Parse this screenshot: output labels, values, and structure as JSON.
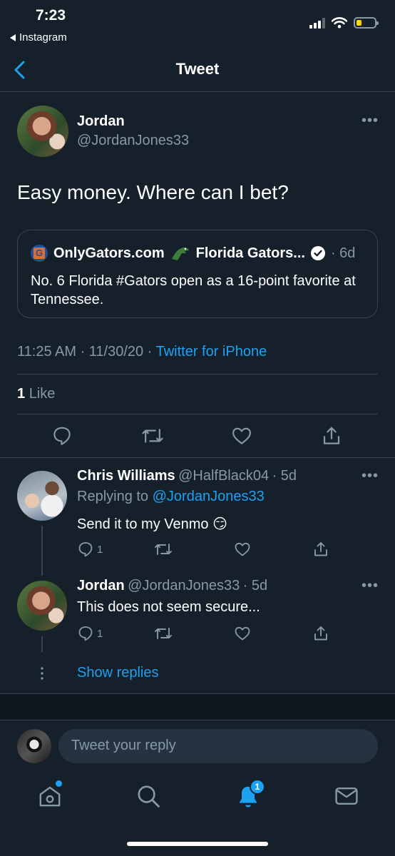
{
  "status_bar": {
    "time": "7:23",
    "back_app": "Instagram"
  },
  "header": {
    "title": "Tweet"
  },
  "main_tweet": {
    "name": "Jordan",
    "handle": "@JordanJones33",
    "text": "Easy money. Where can I bet?",
    "quote": {
      "site": "OnlyGators.com",
      "name": "Florida Gators...",
      "time": "· 6d",
      "text": "No. 6 Florida #Gators open as a 16-point favorite at Tennessee."
    },
    "time": "11:25 AM · 11/30/20 ·",
    "source": "Twitter for iPhone",
    "likes_count": "1",
    "likes_label": "Like"
  },
  "replies": [
    {
      "name": "Chris Williams",
      "handle": "@HalfBlack04",
      "time": "· 5d",
      "replying_prefix": "Replying to",
      "replying_handle": "@JordanJones33",
      "text": "Send it to my Venmo 😏",
      "reply_count": "1"
    },
    {
      "name": "Jordan",
      "handle": "@JordanJones33",
      "time": "· 5d",
      "text": "This does not seem secure...",
      "reply_count": "1"
    }
  ],
  "show_replies": "Show replies",
  "compose": {
    "placeholder": "Tweet your reply"
  },
  "tabbar": {
    "notifications_badge": "1"
  },
  "colors": {
    "background": "#15202b",
    "accent": "#1da1f2",
    "secondary_text": "#8899a6",
    "divider": "#38444d"
  }
}
